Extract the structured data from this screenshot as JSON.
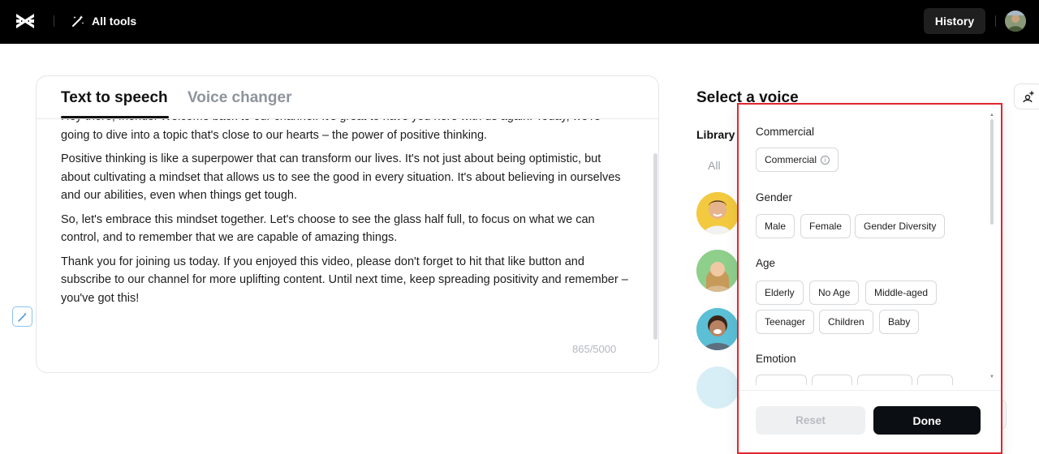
{
  "topbar": {
    "all_tools_label": "All tools",
    "history_label": "History"
  },
  "editor": {
    "tabs": [
      {
        "label": "Text to speech",
        "active": true
      },
      {
        "label": "Voice changer",
        "active": false
      }
    ],
    "paragraphs": [
      "Hey there, friends! Welcome back to our channel. It's great to have you here with us again. Today, we're going to dive into a topic that's close to our hearts – the power of positive thinking.",
      "Positive thinking is like a superpower that can transform our lives. It's not just about being optimistic, but about cultivating a mindset that allows us to see the good in every situation. It's about believing in ourselves and our abilities, even when things get tough.",
      "So, let's embrace this mindset together. Let's choose to see the glass half full, to focus on what we can control, and to remember that we are capable of amazing things.",
      "Thank you for joining us today. If you enjoyed this video, please don't forget to hit that like button and subscribe to our channel for more uplifting content. Until next time, keep spreading positivity and remember – you've got this!"
    ],
    "char_count": "865/5000"
  },
  "voice_panel": {
    "title": "Select a voice",
    "library_label": "Library",
    "filter_all_label": "All"
  },
  "filter": {
    "sections": [
      {
        "title": "Commercial",
        "chips": [
          "Commercial"
        ]
      },
      {
        "title": "Gender",
        "chips": [
          "Male",
          "Female",
          "Gender Diversity"
        ]
      },
      {
        "title": "Age",
        "chips": [
          "Elderly",
          "No Age",
          "Middle-aged",
          "Teenager",
          "Children",
          "Baby"
        ]
      },
      {
        "title": "Emotion",
        "chips": []
      }
    ],
    "reset_label": "Reset",
    "done_label": "Done"
  },
  "colors": {
    "topbar_bg": "#000000",
    "highlight_border": "#e0262f",
    "done_bg": "#0b0f14"
  }
}
